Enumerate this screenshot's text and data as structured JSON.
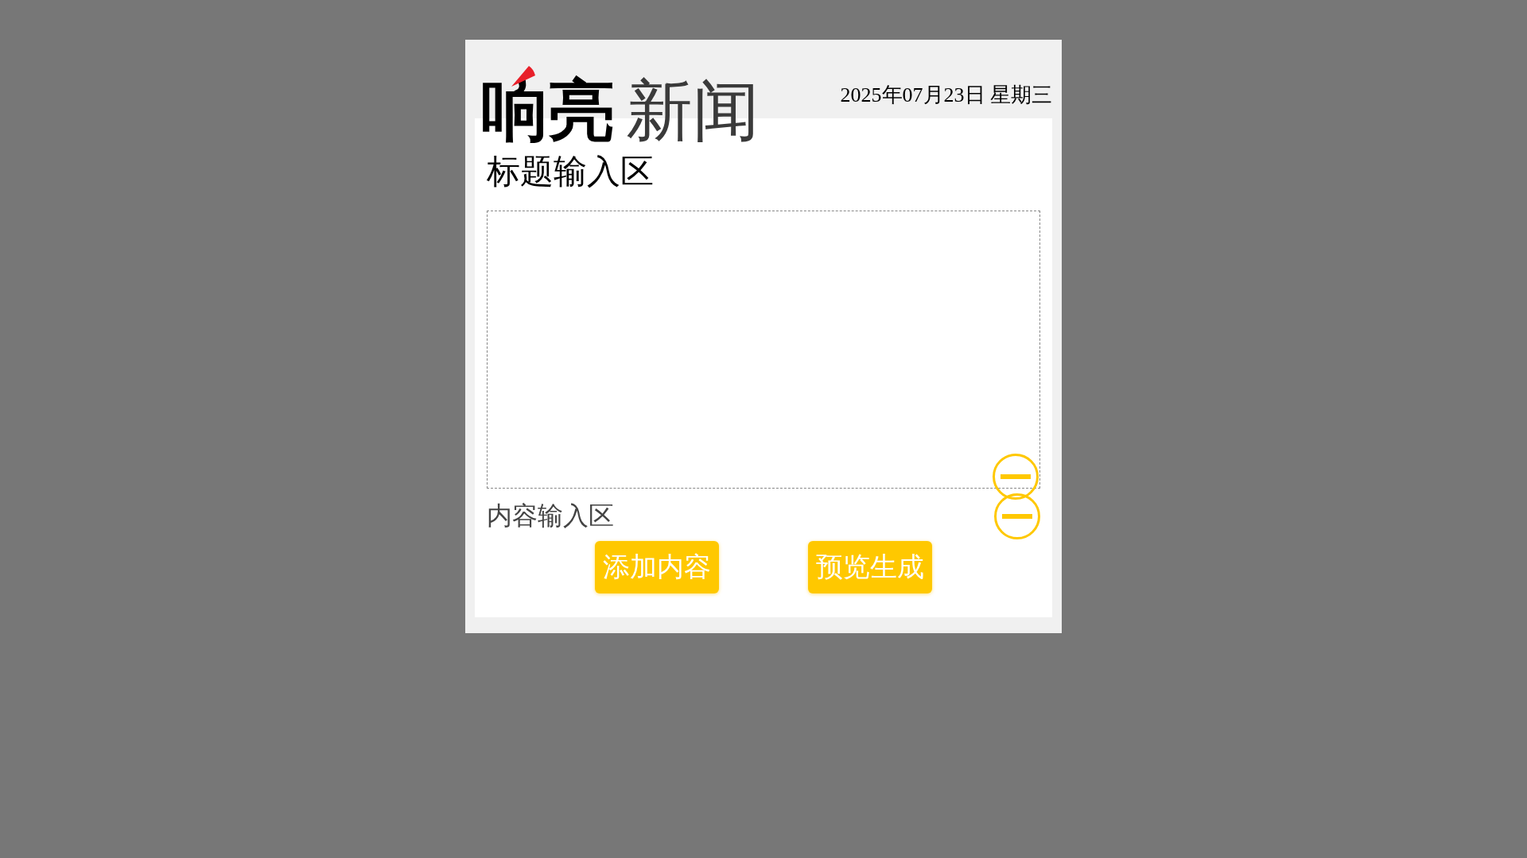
{
  "logo": {
    "bold": "响亮",
    "light": "新闻"
  },
  "date": "2025年07月23日 星期三",
  "title_label": "标题输入区",
  "content_label": "内容输入区",
  "buttons": [
    "添加内容",
    "预览生成"
  ]
}
